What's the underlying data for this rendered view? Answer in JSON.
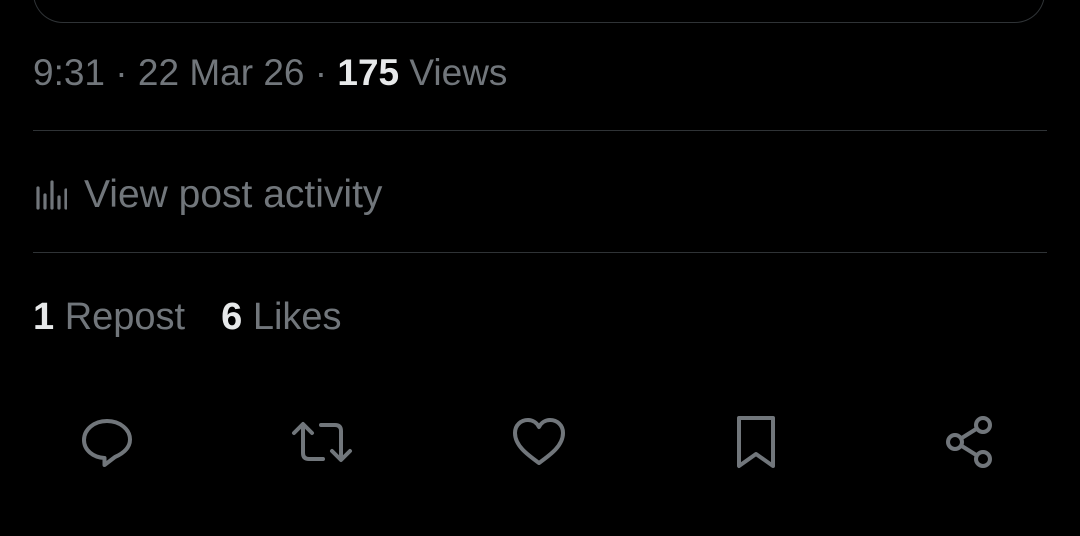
{
  "post_meta": {
    "time": "9:31",
    "separator": "·",
    "date": "22 Mar 26",
    "views_count": "175",
    "views_label": "Views"
  },
  "activity": {
    "icon": "bar-chart-icon",
    "label": "View post activity"
  },
  "stats": {
    "reposts_count": "1",
    "reposts_label": "Repost",
    "likes_count": "6",
    "likes_label": "Likes"
  },
  "actions": [
    {
      "name": "reply",
      "icon": "reply-icon"
    },
    {
      "name": "repost",
      "icon": "repost-icon"
    },
    {
      "name": "like",
      "icon": "heart-icon"
    },
    {
      "name": "bookmark",
      "icon": "bookmark-icon"
    },
    {
      "name": "share",
      "icon": "share-icon"
    }
  ],
  "colors": {
    "background": "#000000",
    "secondary_text": "#71767b",
    "primary_text": "#e7e9ea",
    "divider": "#2f3336"
  }
}
